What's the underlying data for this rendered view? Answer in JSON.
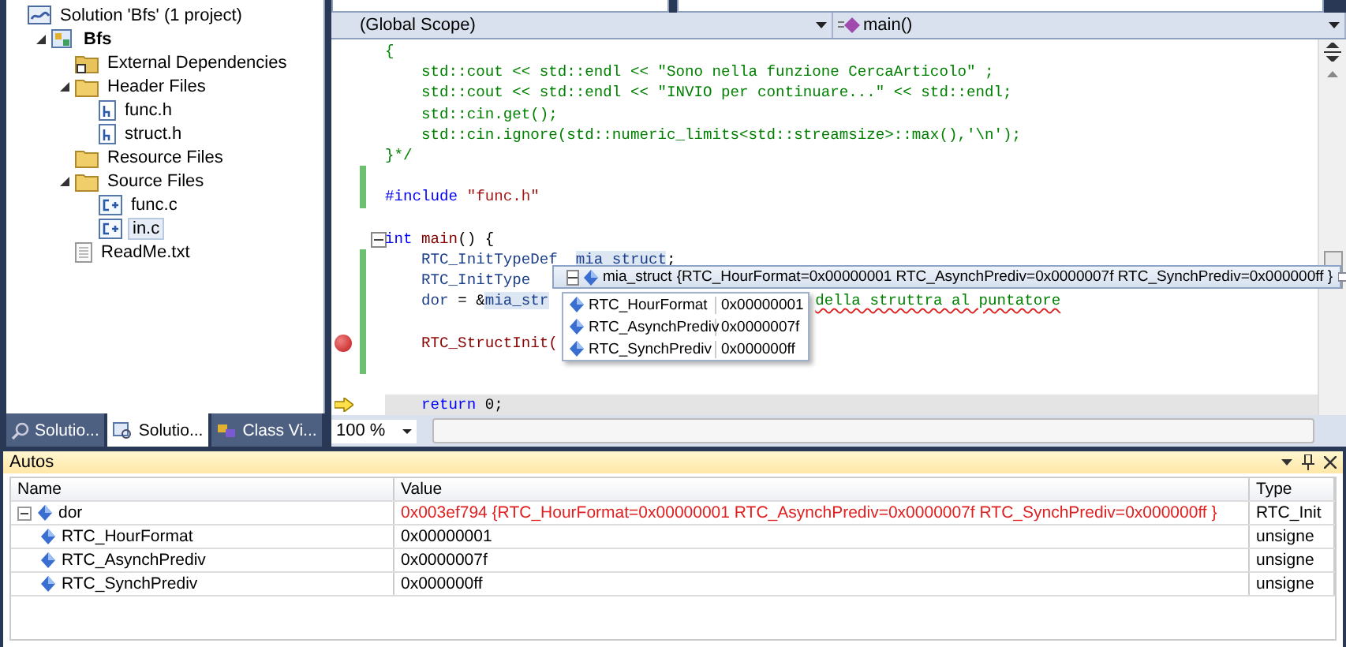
{
  "solution_explorer": {
    "items": [
      {
        "label": "Solution 'Bfs' (1 project)",
        "kind": "solution",
        "selected": false,
        "children": [
          {
            "label": "Bfs",
            "kind": "project",
            "selected": false,
            "expanded": true,
            "children": [
              {
                "label": "External Dependencies",
                "kind": "ref-folder",
                "selected": false
              },
              {
                "label": "Header Files",
                "kind": "folder",
                "selected": false,
                "expanded": true,
                "children": [
                  {
                    "label": "func.h",
                    "kind": "header",
                    "selected": false
                  },
                  {
                    "label": "struct.h",
                    "kind": "header",
                    "selected": false
                  }
                ]
              },
              {
                "label": "Resource Files",
                "kind": "folder",
                "selected": false
              },
              {
                "label": "Source Files",
                "kind": "folder",
                "selected": false,
                "expanded": true,
                "children": [
                  {
                    "label": "func.c",
                    "kind": "source",
                    "selected": false
                  },
                  {
                    "label": "in.c",
                    "kind": "source",
                    "selected": true
                  }
                ]
              },
              {
                "label": "ReadMe.txt",
                "kind": "text",
                "selected": false
              }
            ]
          }
        ]
      }
    ],
    "tabs": [
      {
        "label": "Solutio...",
        "kind": "search",
        "selected": false
      },
      {
        "label": "Solutio...",
        "kind": "solution",
        "selected": true
      },
      {
        "label": "Class Vi...",
        "kind": "class",
        "selected": false
      }
    ]
  },
  "editor": {
    "scope": "(Global Scope)",
    "member": "main()",
    "zoom": "100 %",
    "lines": [
      {
        "modified": false,
        "breakpoint": false,
        "current": false,
        "collapsible": false,
        "segments": [
          {
            "kind": "comment",
            "text": "{"
          }
        ]
      },
      {
        "modified": false,
        "breakpoint": false,
        "current": false,
        "collapsible": false,
        "segments": [
          {
            "kind": "comment",
            "text": "    std::cout << std::endl << \"Sono nella funzione CercaArticolo\" ;"
          }
        ]
      },
      {
        "modified": false,
        "breakpoint": false,
        "current": false,
        "collapsible": false,
        "segments": [
          {
            "kind": "comment",
            "text": "    std::cout << std::endl << \"INVIO per continuare...\" << std::endl;"
          }
        ]
      },
      {
        "modified": false,
        "breakpoint": false,
        "current": false,
        "collapsible": false,
        "segments": [
          {
            "kind": "comment",
            "text": "    std::cin.get();"
          }
        ]
      },
      {
        "modified": false,
        "breakpoint": false,
        "current": false,
        "collapsible": false,
        "segments": [
          {
            "kind": "comment",
            "text": "    std::cin.ignore(std::numeric_limits<std::streamsize>::max(),'\\n');"
          }
        ]
      },
      {
        "modified": false,
        "breakpoint": false,
        "current": false,
        "collapsible": false,
        "segments": [
          {
            "kind": "comment",
            "text": "}*/"
          }
        ]
      },
      {
        "modified": true,
        "breakpoint": false,
        "current": false,
        "collapsible": false
      },
      {
        "modified": true,
        "breakpoint": false,
        "current": false,
        "collapsible": false,
        "segments": [
          {
            "kind": "preprocessor",
            "text": "#include"
          },
          {
            "kind": "string",
            "text": " \"func.h\""
          }
        ]
      },
      {
        "modified": false,
        "breakpoint": false,
        "current": false,
        "collapsible": false
      },
      {
        "modified": false,
        "breakpoint": false,
        "current": false,
        "collapsible": true,
        "segments": [
          {
            "kind": "keyword",
            "text": "int"
          },
          {
            "kind": "function",
            "text": " main"
          },
          {
            "kind": "plain",
            "text": "() {"
          }
        ]
      },
      {
        "modified": true,
        "breakpoint": false,
        "current": false,
        "collapsible": false,
        "segments": [
          {
            "kind": "identifier",
            "text": "    RTC_InitTypeDef  "
          },
          {
            "kind": "highlighted",
            "text": "mia struct"
          },
          {
            "kind": "plain",
            "text": ";"
          }
        ]
      },
      {
        "modified": true,
        "breakpoint": false,
        "current": false,
        "collapsible": false,
        "segments": [
          {
            "kind": "identifier",
            "text": "    RTC_InitType"
          }
        ]
      },
      {
        "modified": true,
        "breakpoint": false,
        "current": false,
        "collapsible": false,
        "segments": [
          {
            "kind": "identifier",
            "text": "    dor"
          },
          {
            "kind": "plain",
            "text": " = &"
          },
          {
            "kind": "highlighted",
            "text": "mia_str"
          },
          {
            "kind": "comment-after-tip",
            "text": "della struttra al puntatore"
          }
        ]
      },
      {
        "modified": true,
        "breakpoint": false,
        "current": false,
        "collapsible": false
      },
      {
        "modified": true,
        "breakpoint": true,
        "current": false,
        "collapsible": false,
        "segments": [
          {
            "kind": "function",
            "text": "    RTC_StructInit("
          }
        ]
      },
      {
        "modified": true,
        "breakpoint": false,
        "current": false,
        "collapsible": false
      },
      {
        "modified": false,
        "breakpoint": false,
        "current": false,
        "collapsible": false
      },
      {
        "modified": false,
        "breakpoint": false,
        "current": true,
        "collapsible": false,
        "segments": [
          {
            "kind": "keyword",
            "text": "    return"
          },
          {
            "kind": "plain",
            "text": " 0;"
          }
        ]
      }
    ],
    "datatip": {
      "name": "mia_struct",
      "value": "{RTC_HourFormat=0x00000001 RTC_AsynchPrediv=0x0000007f RTC_SynchPrediv=0x000000ff }",
      "expanded": true,
      "members": [
        {
          "name": "RTC_HourFormat",
          "value": "0x00000001"
        },
        {
          "name": "RTC_AsynchPrediv",
          "value": "0x0000007f"
        },
        {
          "name": "RTC_SynchPrediv",
          "value": "0x000000ff"
        }
      ]
    }
  },
  "autos": {
    "title": "Autos",
    "columns": [
      "Name",
      "Value",
      "Type"
    ],
    "rows": [
      {
        "name": "dor",
        "value": "0x003ef794 {RTC_HourFormat=0x00000001 RTC_AsynchPrediv=0x0000007f RTC_SynchPrediv=0x000000ff }",
        "type": "RTC_Init",
        "changed": true,
        "expanded": true,
        "children": [
          {
            "name": "RTC_HourFormat",
            "value": "0x00000001",
            "type": "unsigne",
            "changed": false
          },
          {
            "name": "RTC_AsynchPrediv",
            "value": "0x0000007f",
            "type": "unsigne",
            "changed": false
          },
          {
            "name": "RTC_SynchPrediv",
            "value": "0x000000ff",
            "type": "unsigne",
            "changed": false
          }
        ]
      }
    ]
  }
}
